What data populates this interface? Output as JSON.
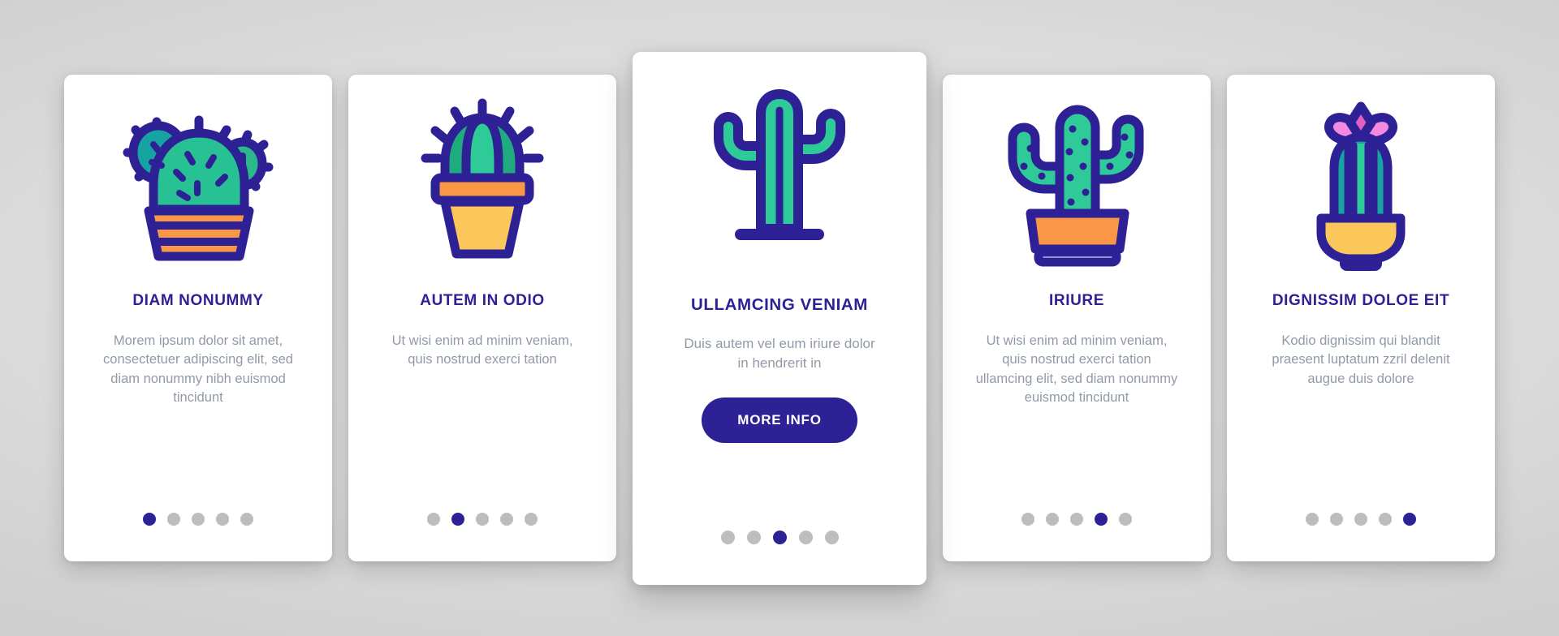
{
  "palette": {
    "background_outer": "#bdbdbd",
    "background_inner": "#e3e3e3",
    "card_background": "#ffffff",
    "accent_indigo": "#2e2196",
    "body_text": "#919aa6",
    "dot_inactive": "#bdbdbd",
    "cactus_green": "#23b98a",
    "cactus_green_dark": "#1ea57a",
    "cactus_teal": "#18a3a3",
    "pot_orange": "#f99746",
    "pot_yellow": "#fbc75a",
    "flower_pink": "#f389e0",
    "flower_pink_dark": "#e060c4"
  },
  "screens": [
    {
      "id": "screen-1",
      "icon": "prickly-pear-cactus-in-striped-pot-icon",
      "title": "DIAM NONUMMY",
      "body": "Morem ipsum dolor sit amet, consectetuer adipiscing elit, sed diam nonummy nibh euismod tincidunt",
      "featured": false,
      "cta": null,
      "dots_total": 5,
      "dot_active_index": 0
    },
    {
      "id": "screen-2",
      "icon": "barrel-cactus-in-yellow-pot-icon",
      "title": "AUTEM IN ODIO",
      "body": "Ut wisi enim ad minim veniam, quis nostrud exerci tation",
      "featured": false,
      "cta": null,
      "dots_total": 5,
      "dot_active_index": 1
    },
    {
      "id": "screen-3",
      "icon": "saguaro-cactus-icon",
      "title": "ULLAMCING VENIAM",
      "body": "Duis autem vel eum iriure dolor in hendrerit in",
      "featured": true,
      "cta": "MORE INFO",
      "dots_total": 5,
      "dot_active_index": 2
    },
    {
      "id": "screen-4",
      "icon": "spotted-cactus-in-orange-pot-icon",
      "title": "IRIURE",
      "body": "Ut wisi enim ad minim veniam, quis nostrud exerci tation ullamcing elit, sed diam nonummy euismod tincidunt",
      "featured": false,
      "cta": null,
      "dots_total": 5,
      "dot_active_index": 3
    },
    {
      "id": "screen-5",
      "icon": "flowering-cactus-in-bowl-icon",
      "title": "DIGNISSIM DOLOE EIT",
      "body": "Kodio dignissim qui blandit praesent luptatum zzril delenit augue duis dolore",
      "featured": false,
      "cta": null,
      "dots_total": 5,
      "dot_active_index": 4
    }
  ]
}
